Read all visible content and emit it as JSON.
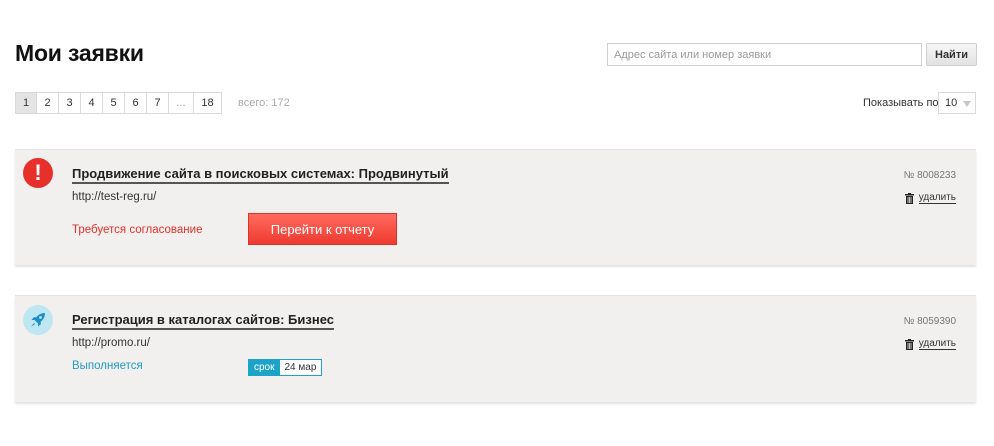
{
  "page_title": "Мои заявки",
  "search": {
    "placeholder": "Адрес сайта или номер заявки",
    "value": "",
    "button_label": "Найти"
  },
  "pagination": {
    "pages": [
      "1",
      "2",
      "3",
      "4",
      "5",
      "6",
      "7",
      "...",
      "18"
    ],
    "active": "1",
    "total_text": "всего: 172"
  },
  "per_page": {
    "label": "Показывать по",
    "value": "10"
  },
  "orders": [
    {
      "title": "Продвижение сайта в поисковых системах: Продвинутый",
      "url": "http://test-reg.ru/",
      "number": "№ 8008233",
      "delete_label": "удалить",
      "status": "Требуется согласование",
      "status_color": "#e0322a",
      "icon": "alert-icon",
      "action_label": "Перейти к отчету"
    },
    {
      "title": "Регистрация в каталогах сайтов: Бизнес",
      "url": "http://promo.ru/",
      "number": "№ 8059390",
      "delete_label": "удалить",
      "status": "Выполняется",
      "status_color": "#1f9cc0",
      "icon": "rocket-icon",
      "deadline_label": "срок",
      "deadline_value": "24 мар"
    }
  ],
  "colors": {
    "accent_red": "#ee3a30",
    "accent_blue": "#1ea3c8",
    "card_bg": "#f2efef"
  }
}
